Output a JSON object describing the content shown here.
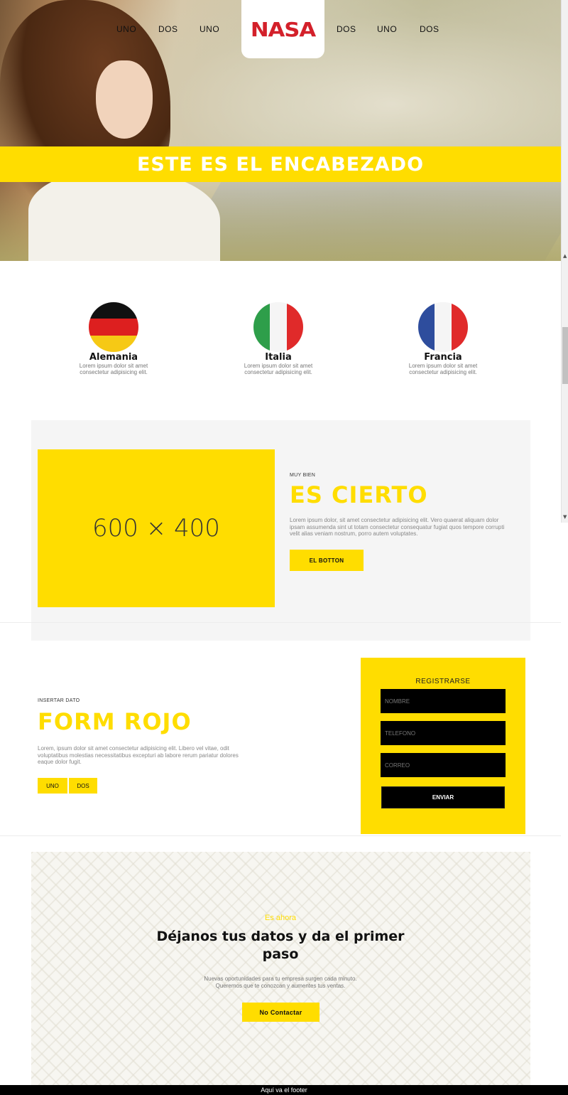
{
  "nav": {
    "left_links": [
      "UNO",
      "DOS",
      "UNO"
    ],
    "right_links": [
      "DOS",
      "UNO",
      "DOS"
    ],
    "logo": "NASA"
  },
  "hero": {
    "heading": "ESTE ES EL ENCABEZADO"
  },
  "countries": [
    {
      "name": "Alemania",
      "text": "Lorem ipsum dolor sit amet consectetur adipisicing elit.",
      "flag": "germany-flag"
    },
    {
      "name": "Italia",
      "text": "Lorem ipsum dolor sit amet consectetur adipisicing elit.",
      "flag": "italy-flag"
    },
    {
      "name": "Francia",
      "text": "Lorem ipsum dolor sit amet consectetur adipisicing elit.",
      "flag": "france-flag"
    }
  ],
  "feature": {
    "placeholder": "600 × 400",
    "kicker": "MUY BIEN",
    "title": "ES CIERTO",
    "text": "Lorem ipsum dolor, sit amet consectetur adipisicing elit. Vero quaerat aliquam dolor ipsam assumenda sint ut totam consectetur consequatur fugiat quos tempore corrupti velit alias veniam nostrum, porro autem voluptates.",
    "button": "EL BOTTON"
  },
  "form_section": {
    "kicker": "INSERTAR DATO",
    "title": "FORM ROJO",
    "text": "Lorem, ipsum dolor sit amet consectetur adipisicing elit. Libero vel vitae, odit voluptatibus molestias necessitatibus excepturi ab labore rerum pariatur dolores eaque dolor fugit.",
    "buttons": [
      "UNO",
      "DOS"
    ]
  },
  "register": {
    "title": "REGISTRARSE",
    "fields": [
      "NOMBRE",
      "TELEFONO",
      "CORREO"
    ],
    "submit": "ENVIAR"
  },
  "cta": {
    "kicker": "Es ahora",
    "title": "Déjanos tus datos y da el primer paso",
    "text_line1": "Nuevas oportunidades para tu empresa surgen cada minuto.",
    "text_line2": "Queremos que te conozcan y aumentes tus ventas.",
    "button": "No Contactar"
  },
  "footer": {
    "text": "Aquí va el footer"
  },
  "colors": {
    "accent": "#ffdd00",
    "logo": "#d3202a",
    "dark": "#000000"
  }
}
